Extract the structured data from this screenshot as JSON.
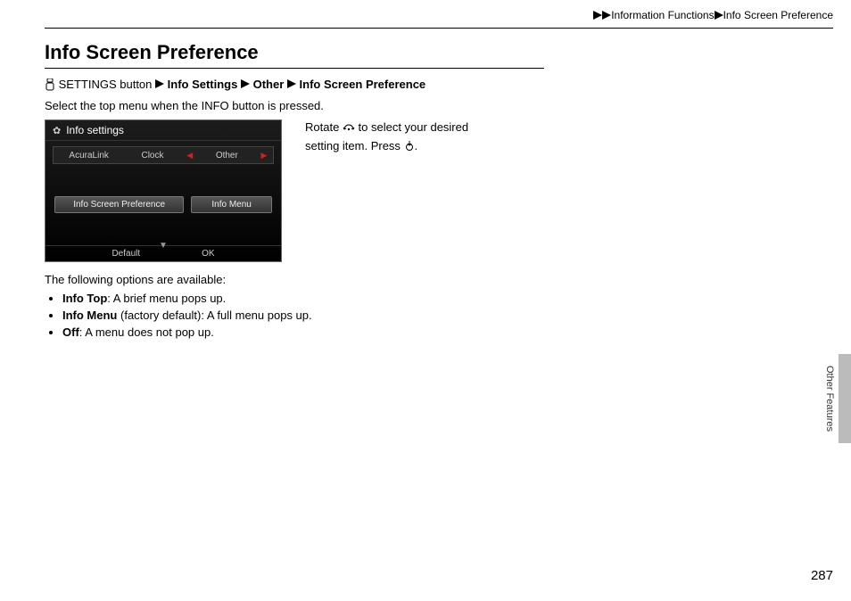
{
  "header": {
    "breadcrumb1": "Information Functions",
    "breadcrumb2": "Info Screen Preference"
  },
  "title": "Info Screen Preference",
  "nav": {
    "settings_label": "SETTINGS button",
    "step1": "Info Settings",
    "step2": "Other",
    "step3": "Info Screen Preference"
  },
  "intro": "Select the top menu when the INFO button is pressed.",
  "instruct": {
    "part1": "Rotate ",
    "part2": " to select your desired setting item. Press ",
    "part3": "."
  },
  "screenshot": {
    "title": "Info settings",
    "tabs": [
      "AcuraLink",
      "Clock",
      "Other"
    ],
    "buttons": [
      "Info Screen Preference",
      "Info Menu"
    ],
    "bottom": [
      "Default",
      "OK"
    ]
  },
  "options_intro": "The following options are available:",
  "options": [
    {
      "name": "Info Top",
      "desc": ": A brief menu pops up."
    },
    {
      "name": "Info Menu",
      "desc": " (factory default): A full menu pops up."
    },
    {
      "name": "Off",
      "desc": ": A menu does not pop up."
    }
  ],
  "side_label": "Other Features",
  "page_number": "287"
}
